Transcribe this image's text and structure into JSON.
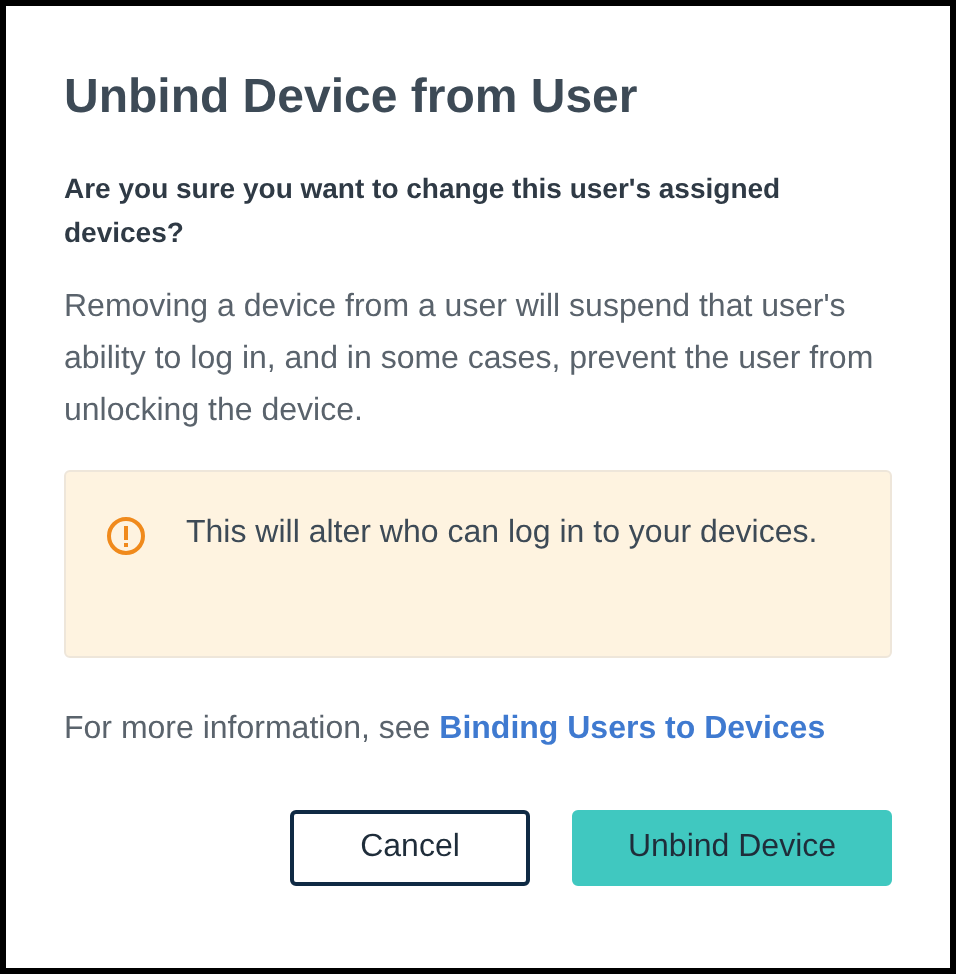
{
  "dialog": {
    "title": "Unbind Device from User",
    "question": "Are you sure you want to change this user's assigned devices?",
    "description": "Removing a device from a user will suspend that user's ability to log in, and in some cases, prevent the user from unlocking the device.",
    "warning": {
      "text": "This will alter who can log in to your devices."
    },
    "info": {
      "text": "For more information, see",
      "link": "Binding Users to Devices"
    },
    "buttons": [
      {
        "label": "Cancel",
        "kind": "secondary"
      },
      {
        "label": "Unbind Device",
        "kind": "primary"
      }
    ]
  }
}
